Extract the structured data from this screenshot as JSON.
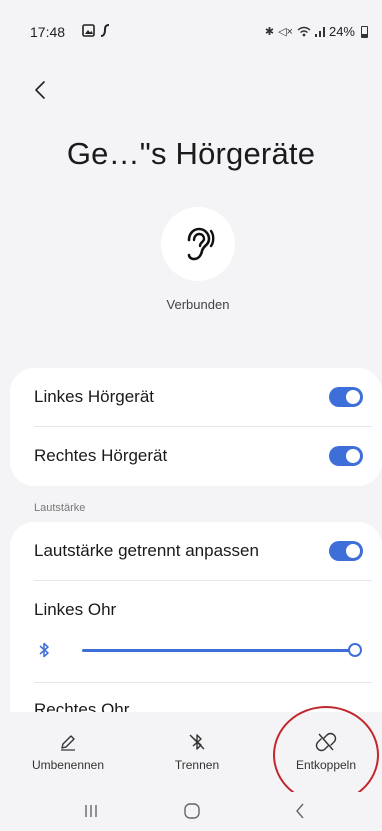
{
  "status_bar": {
    "time": "17:48",
    "battery": "24%"
  },
  "header": {
    "title": "Ge…\"s Hörgeräte"
  },
  "device": {
    "icon": "ear-icon",
    "status": "Verbunden"
  },
  "devices_card": {
    "items": [
      {
        "label": "Linkes Hörgerät",
        "enabled": true
      },
      {
        "label": "Rechtes Hörgerät",
        "enabled": true
      }
    ]
  },
  "volume": {
    "section_label": "Lautstärke",
    "separate_label": "Lautstärke getrennt anpassen",
    "separate_enabled": true,
    "left_ear_label": "Linkes Ohr",
    "left_ear_level": 1.0,
    "right_ear_label": "Rechtes Ohr"
  },
  "actions": {
    "rename": "Umbenennen",
    "disconnect": "Trennen",
    "unpair": "Entkoppeln"
  },
  "colors": {
    "accent": "#3e6fd8",
    "annotation": "#c1272d",
    "background": "#f4f4f6"
  }
}
